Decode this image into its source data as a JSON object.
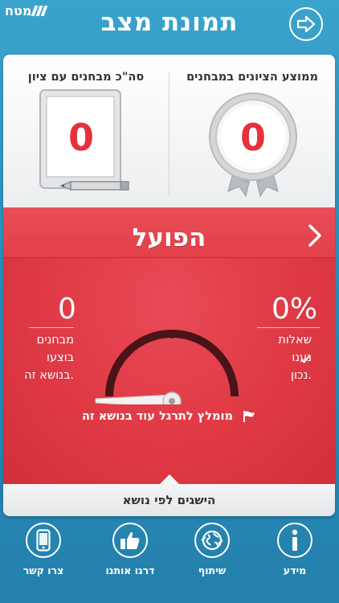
{
  "header": {
    "logo_text": "מטח",
    "title": "תמונת מצב"
  },
  "stats": {
    "avg_grade_label": "ממוצע הציונים במבחנים",
    "avg_grade_value": "0",
    "total_exams_label": "סה\"כ מבחנים עם ציון",
    "total_exams_value": "0"
  },
  "topic": {
    "title": "הפועל",
    "correct_percent": "0%",
    "correct_text": [
      "שאלות",
      "נענו",
      "נכון."
    ],
    "exams_count": "0",
    "exams_text": [
      "מבחנים",
      "בוצעו",
      "בנושא זה."
    ],
    "gauge_level": 0,
    "recommendation": "מומלץ לתרגל עוד בנושא זה"
  },
  "achievements_label": "הישגים לפי נושא",
  "nav": [
    {
      "label": "מידע",
      "icon": "info-icon"
    },
    {
      "label": "שיתוף",
      "icon": "share-globe-icon"
    },
    {
      "label": "דרגו אותנו",
      "icon": "thumbs-up-icon"
    },
    {
      "label": "צרו קשר",
      "icon": "phone-icon"
    }
  ],
  "colors": {
    "accent_red": "#e23f4a",
    "header_blue": "#2a90bd"
  }
}
